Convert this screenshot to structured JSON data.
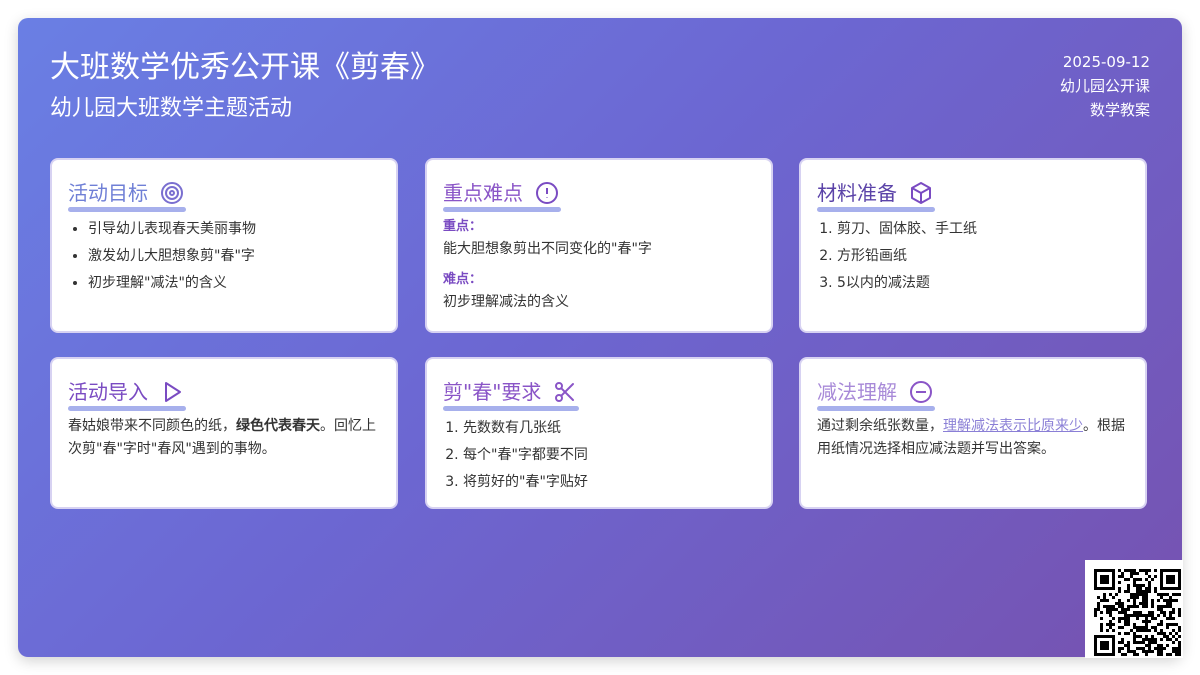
{
  "header": {
    "title": "大班数学优秀公开课《剪春》",
    "subtitle": "幼儿园大班数学主题活动",
    "date": "2025-09-12",
    "category": "幼儿园公开课",
    "type": "数学教案"
  },
  "cards": {
    "goals": {
      "title": "活动目标",
      "icon": "target-icon",
      "items": [
        "引导幼儿表现春天美丽事物",
        "激发幼儿大胆想象剪\"春\"字",
        "初步理解\"减法\"的含义"
      ]
    },
    "key_points": {
      "title": "重点难点",
      "icon": "alert-circle-icon",
      "key_label": "重点：",
      "key_text": "能大胆想象剪出不同变化的\"春\"字",
      "difficulty_label": "难点：",
      "difficulty_text": "初步理解减法的含义"
    },
    "materials": {
      "title": "材料准备",
      "icon": "box-icon",
      "items": [
        "剪刀、固体胶、手工纸",
        "方形铅画纸",
        "5以内的减法题"
      ]
    },
    "intro": {
      "title": "活动导入",
      "icon": "play-icon",
      "text_before": "春姑娘带来不同颜色的纸，",
      "text_bold": "绿色代表春天",
      "text_after": "。回忆上次剪\"春\"字时\"春风\"遇到的事物。"
    },
    "requirements": {
      "title": "剪\"春\"要求",
      "icon": "scissors-icon",
      "items": [
        "先数数有几张纸",
        "每个\"春\"字都要不同",
        "将剪好的\"春\"字贴好"
      ]
    },
    "subtraction": {
      "title": "减法理解",
      "icon": "minus-circle-icon",
      "text_before": "通过剩余纸张数量，",
      "text_link": "理解减法表示比原来少",
      "text_after": "。根据用纸情况选择相应减法题并写出答案。"
    }
  },
  "colors": {
    "title_blue": "#6f7fd6",
    "title_purple": "#8a55c7",
    "underline": "#a7b0ec"
  },
  "qr": {
    "icon": "qr-code-icon"
  }
}
